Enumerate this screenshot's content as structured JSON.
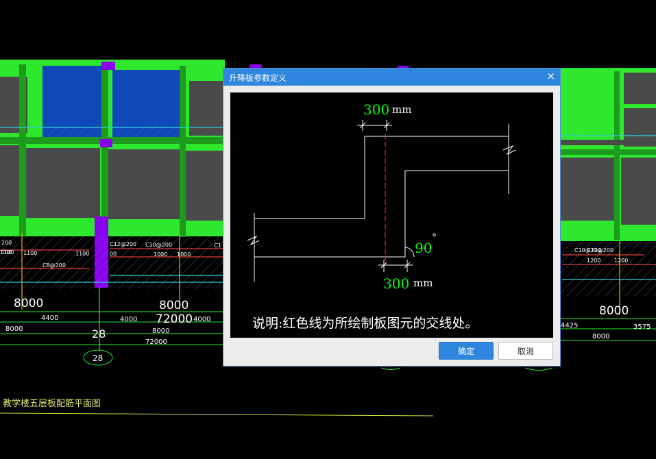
{
  "background": {
    "plan_title": "教学楼五层板配筋平面图",
    "dims_large": [
      "8000",
      "8000",
      "72000",
      "8000"
    ],
    "dims_small": [
      "4400",
      "8000",
      "4000",
      "8000",
      "72000",
      "4000",
      "4425",
      "3575",
      "8000"
    ],
    "axis_labels": [
      "28",
      "28"
    ],
    "rebar_labels": [
      "C12@200",
      "C10@200",
      "C8@200",
      "C10@200",
      "C12@200"
    ],
    "rebar_lengths": [
      "1100",
      "1100",
      "1100",
      "1000",
      "1000",
      "1200",
      "1200"
    ],
    "partial_labels": [
      "200",
      "100",
      "00",
      "C1"
    ]
  },
  "dialog": {
    "title": "升降板参数定义",
    "close_glyph": "×",
    "ok_label": "确定",
    "cancel_label": "取消",
    "diagram": {
      "top_offset_value": "300",
      "top_offset_unit": "mm",
      "bottom_offset_value": "300",
      "bottom_offset_unit": "mm",
      "angle_value": "90",
      "angle_unit": "°",
      "note": "说明:红色线为所绘制板图元的交线处。"
    }
  },
  "colors": {
    "beam_green": "#2ee82e",
    "beam_dark_green": "#1c9b1c",
    "slab_gray": "#4a4a4a",
    "slab_blue": "#0f48b8",
    "column_purple": "#8a00f0",
    "dialog_blue": "#2e86de",
    "param_green": "#00ff00",
    "intersection_red": "#e0302a"
  }
}
